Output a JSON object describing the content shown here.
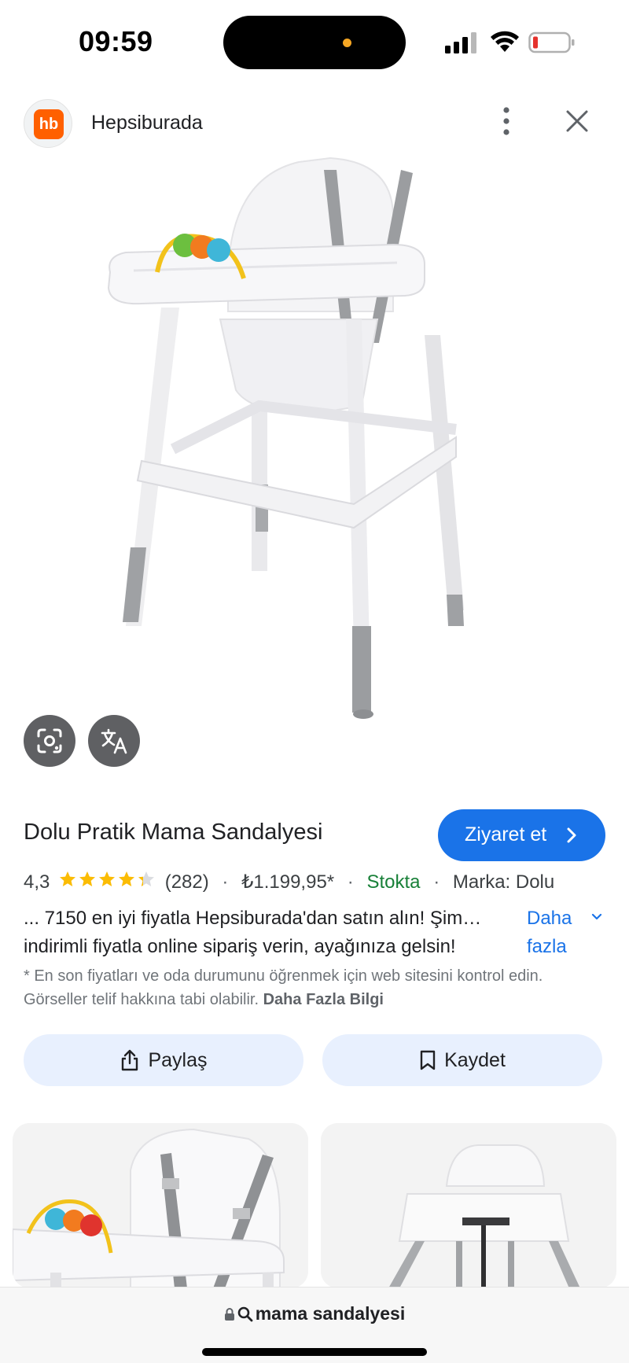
{
  "status_bar": {
    "time": "09:59"
  },
  "header": {
    "site_name": "Hepsiburada",
    "favicon_text": "hb",
    "favicon_color": "#ff6000"
  },
  "icons": {
    "lens": "google-lens-icon",
    "translate": "translate-icon",
    "more": "more-vert-icon",
    "close": "close-icon",
    "share": "share-icon",
    "save": "bookmark-icon",
    "lock": "lock-icon",
    "search": "search-icon"
  },
  "product": {
    "title": "Dolu Pratik Mama Sandalyesi",
    "visit_label": "Ziyaret et",
    "rating": "4,3",
    "rating_value": 4.3,
    "reviews": "(282)",
    "price": "₺1.199,95*",
    "stock": "Stokta",
    "brand": "Marka: Dolu",
    "desc_line1": "... 7150 en iyi fiyatla Hepsiburada'dan satın alın! Şim…",
    "desc_line2": "indirimli fiyatla online sipariş verin, ayağınıza gelsin!",
    "more_label": "Daha fazla",
    "disclaimer": "* En son fiyatları ve oda durumunu öğrenmek için web sitesini kontrol edin. Görseller telif hakkına tabi olabilir.",
    "disclaimer_link": "Daha Fazla Bilgi"
  },
  "actions": {
    "share_label": "Paylaş",
    "save_label": "Kaydet"
  },
  "bottom_bar": {
    "query": "mama sandalyesi"
  },
  "colors": {
    "accent": "#1a73e8",
    "stock_green": "#188038",
    "star": "#fbbc04",
    "button_bg": "#e8f0fe"
  }
}
